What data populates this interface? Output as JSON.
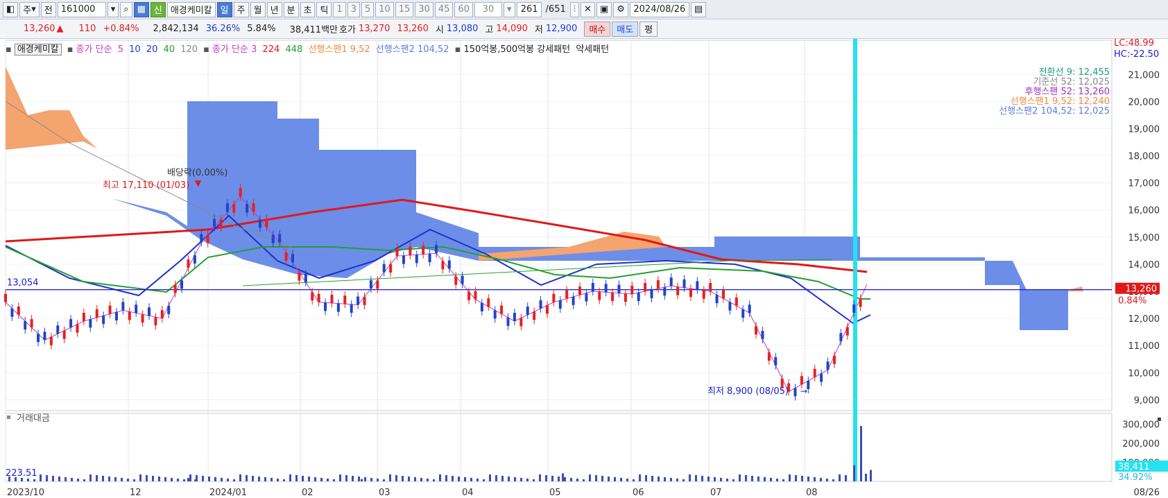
{
  "toolbar": {
    "market": "주",
    "prev_label": "전",
    "code": "161000",
    "new_label": "신",
    "stock_name": "애경케미칼",
    "periods": [
      "일",
      "주",
      "월",
      "년",
      "분",
      "초",
      "틱"
    ],
    "active_period": "일",
    "intervals": [
      "1",
      "3",
      "5",
      "10",
      "15",
      "30",
      "45",
      "60"
    ],
    "interval_value": "30",
    "count": "261",
    "total": "/651",
    "date": "2024/08/26"
  },
  "info": {
    "price": "13,260",
    "change_arrow": "▲",
    "change": "110",
    "change_pct": "+0.84%",
    "volume": "2,842,134",
    "ratio1": "36.26%",
    "ratio2": "5.84%",
    "trade_value": "38,411백만",
    "quote_label": "호가",
    "ask": "13,270",
    "bid": "13,260",
    "open_label": "시",
    "open": "13,080",
    "high_label": "고",
    "high": "14,090",
    "low_label": "저",
    "low": "12,900",
    "buy_label": "매수",
    "sell_label": "매도",
    "avg_label": "평"
  },
  "legend": {
    "name": "애경케미칼",
    "ma_label": "종가 단순",
    "ma_periods": [
      "5",
      "10",
      "20",
      "40",
      "120"
    ],
    "ma2_label": "종가 단순 3",
    "ma2_periods": [
      "224",
      "448"
    ],
    "span1_label": "선행스팬1 9,52",
    "span2_label": "선행스팬2 104,52",
    "pattern_label": "150억봉,500억봉 강세패턴",
    "weak_label": "약세패턴"
  },
  "ichimoku_values": {
    "conv": "전환선 9: 12,455",
    "base": "기준선 52: 12,025",
    "lag": "후행스팬 52: 13,260",
    "span1": "선행스팬1 9,52: 12,240",
    "span2": "선행스팬2 104,52: 12,025"
  },
  "right_labels": {
    "lc": "LC:48.99",
    "hc": "HC:-22.50",
    "current_price": "13,260",
    "current_pct": "0.84%",
    "vol_current": "38,411",
    "vol_pct": "34.92%"
  },
  "annotations": {
    "dividend": "배당락(0.00%)",
    "high": "최고 17,110 (01/03)",
    "low": "최저 8,900 (08/05)",
    "left_price": "13,054",
    "vol_left": "223.51"
  },
  "volume_panel_title": "거래대금",
  "chart_data": {
    "type": "candlestick",
    "x_ticks": [
      "2023/10",
      "12",
      "2024/01",
      "02",
      "03",
      "04",
      "05",
      "06",
      "07",
      "08"
    ],
    "x_end_label": "08/26",
    "price_axis": {
      "ylim": [
        8600,
        21800
      ],
      "ticks": [
        9000,
        10000,
        11000,
        12000,
        13000,
        14000,
        15000,
        16000,
        17000,
        18000,
        19000,
        20000,
        21000
      ]
    },
    "volume_axis": {
      "ylim": [
        0,
        320000
      ],
      "ticks": [
        100000,
        200000,
        300000
      ]
    },
    "key_points": [
      {
        "date": "2024/01/03",
        "high": 17110
      },
      {
        "date": "2024/08/05",
        "low": 8900
      },
      {
        "date": "2024/08/26",
        "close": 13260,
        "open": 13080,
        "high": 14090,
        "low": 12900
      }
    ],
    "close_series_approx": [
      {
        "x": "2023/10",
        "y": 12600
      },
      {
        "x": "2023/10b",
        "y": 11200
      },
      {
        "x": "2023/11",
        "y": 11900
      },
      {
        "x": "2023/11b",
        "y": 12300
      },
      {
        "x": "2023/12",
        "y": 12000
      },
      {
        "x": "2023/12b",
        "y": 14800
      },
      {
        "x": "2024/01",
        "y": 16500
      },
      {
        "x": "2024/01b",
        "y": 14800
      },
      {
        "x": "2024/02",
        "y": 12600
      },
      {
        "x": "2024/02b",
        "y": 12500
      },
      {
        "x": "2024/03",
        "y": 14300
      },
      {
        "x": "2024/03b",
        "y": 14400
      },
      {
        "x": "2024/04",
        "y": 12700
      },
      {
        "x": "2024/04b",
        "y": 11900
      },
      {
        "x": "2024/05",
        "y": 12600
      },
      {
        "x": "2024/05b",
        "y": 13000
      },
      {
        "x": "2024/06",
        "y": 12900
      },
      {
        "x": "2024/06b",
        "y": 13200
      },
      {
        "x": "2024/07",
        "y": 13000
      },
      {
        "x": "2024/07b",
        "y": 12200
      },
      {
        "x": "2024/08",
        "y": 9300
      },
      {
        "x": "2024/08b",
        "y": 10100
      },
      {
        "x": "2024/08/26",
        "y": 13260
      }
    ]
  },
  "colors": {
    "cloud_blue": "#6c8ee8",
    "cloud_orange": "#f4a46e",
    "ma224": "#e01818",
    "ma120": "#1f2fd0",
    "ma40": "#23a02d",
    "up": "#e82020",
    "down": "#1f45c8",
    "cursor": "#27e1ee"
  }
}
